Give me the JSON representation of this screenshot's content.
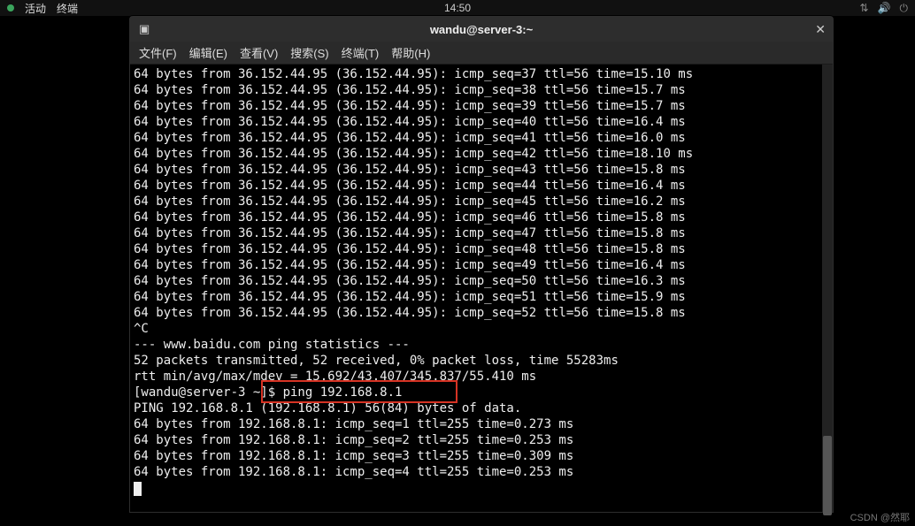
{
  "topbar": {
    "activities": "活动",
    "app": "终端",
    "clock": "14:50"
  },
  "window": {
    "title": "wandu@server-3:~",
    "close_glyph": "✕",
    "term_icon_glyph": "▣"
  },
  "menu": {
    "file": "文件(F)",
    "edit": "编辑(E)",
    "view": "查看(V)",
    "search": "搜索(S)",
    "terminal": "终端(T)",
    "help": "帮助(H)"
  },
  "ping1": {
    "host": "36.152.44.95",
    "paren": "(36.152.44.95)",
    "ttl": "56",
    "rows": [
      {
        "seq": "37",
        "time": "15.10"
      },
      {
        "seq": "38",
        "time": "15.7"
      },
      {
        "seq": "39",
        "time": "15.7"
      },
      {
        "seq": "40",
        "time": "16.4"
      },
      {
        "seq": "41",
        "time": "16.0"
      },
      {
        "seq": "42",
        "time": "18.10"
      },
      {
        "seq": "43",
        "time": "15.8"
      },
      {
        "seq": "44",
        "time": "16.4"
      },
      {
        "seq": "45",
        "time": "16.2"
      },
      {
        "seq": "46",
        "time": "15.8"
      },
      {
        "seq": "47",
        "time": "15.8"
      },
      {
        "seq": "48",
        "time": "15.8"
      },
      {
        "seq": "49",
        "time": "16.4"
      },
      {
        "seq": "50",
        "time": "16.3"
      },
      {
        "seq": "51",
        "time": "15.9"
      },
      {
        "seq": "52",
        "time": "15.8"
      }
    ]
  },
  "interrupt": "^C",
  "stats": {
    "header": "--- www.baidu.com ping statistics ---",
    "summary": "52 packets transmitted, 52 received, 0% packet loss, time 55283ms",
    "rtt": "rtt min/avg/max/mdev = 15.692/43.407/345.837/55.410 ms"
  },
  "prompt": {
    "text": "[wandu@server-3 ~]$ ping 192.168.8.1"
  },
  "ping2": {
    "header": "PING 192.168.8.1 (192.168.8.1) 56(84) bytes of data.",
    "host": "192.168.8.1",
    "ttl": "255",
    "rows": [
      {
        "seq": "1",
        "time": "0.273"
      },
      {
        "seq": "2",
        "time": "0.253"
      },
      {
        "seq": "3",
        "time": "0.309"
      },
      {
        "seq": "4",
        "time": "0.253"
      }
    ]
  },
  "watermark": "CSDN @然耶"
}
